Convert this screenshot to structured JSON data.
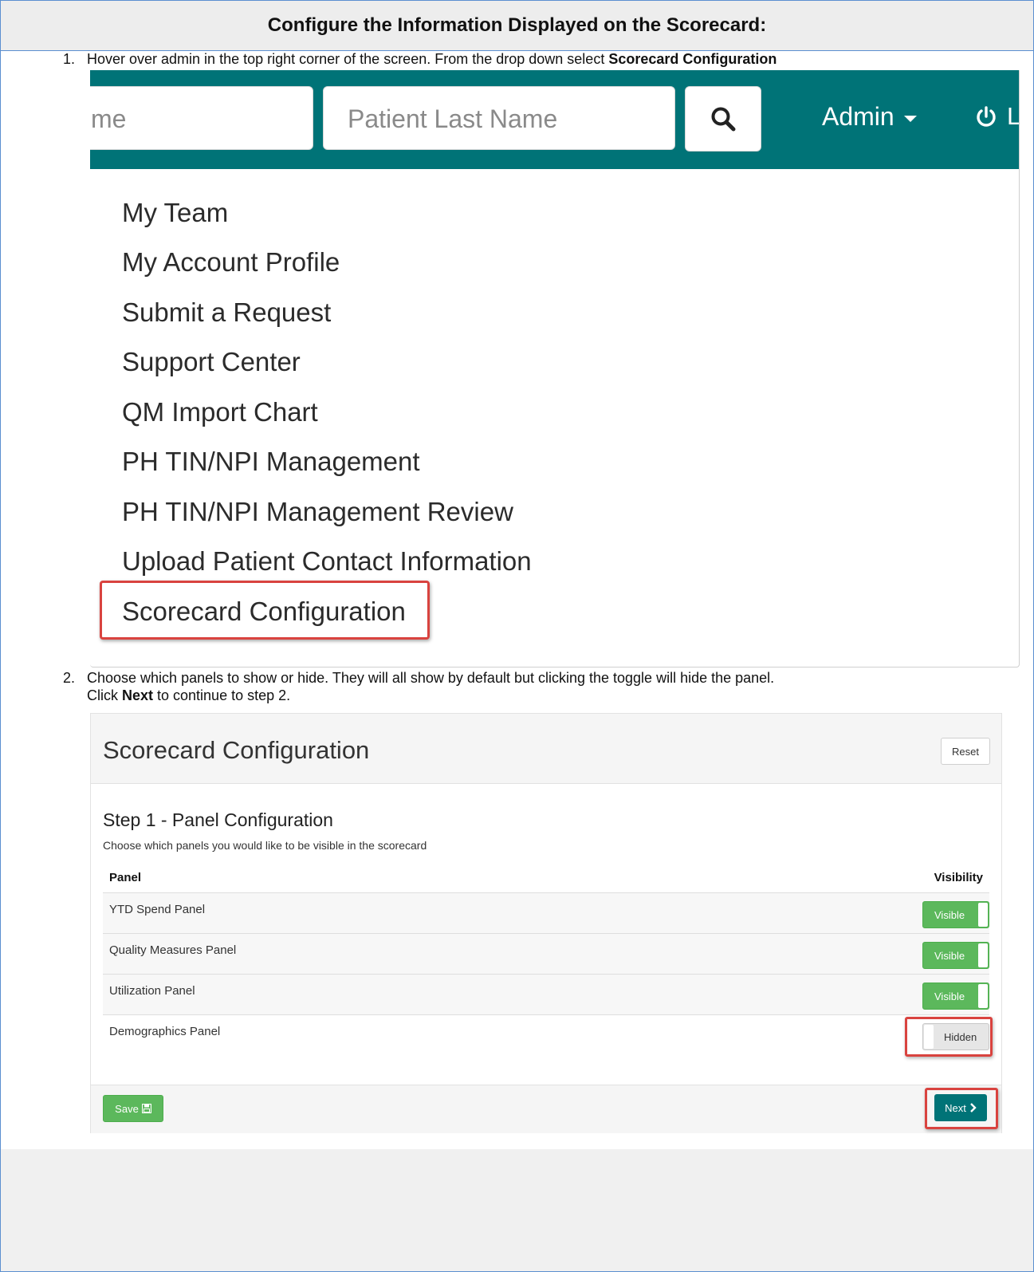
{
  "header": {
    "title": "Configure the Information Displayed on the Scorecard:"
  },
  "steps": [
    {
      "number": "1.",
      "text": "Hover over admin in the top right corner of the screen. From the drop down select ",
      "bold": "Scorecard Configuration"
    },
    {
      "number": "2.",
      "line1": "Choose which panels to show or hide. They will all show by default but clicking the toggle will hide the panel.",
      "line2_prefix": "Click ",
      "line2_bold": "Next",
      "line2_suffix": " to continue to step 2."
    }
  ],
  "navbar": {
    "first_input_text": "me",
    "last_name_placeholder": "Patient Last Name",
    "admin_label": "Admin",
    "logout_label": "Logout",
    "colors": {
      "navbar_bg": "#007377"
    }
  },
  "dropdown": {
    "items": [
      "My Team",
      "My Account Profile",
      "Submit a Request",
      "Support Center",
      "QM Import Chart",
      "PH TIN/NPI Management",
      "PH TIN/NPI Management Review",
      "Upload Patient Contact Information",
      "Scorecard Configuration"
    ],
    "highlighted_item": "Scorecard Configuration"
  },
  "scorecard": {
    "title": "Scorecard Configuration",
    "reset_label": "Reset",
    "step_title": "Step 1 - Panel Configuration",
    "step_desc": "Choose which panels you would like to be visible in the scorecard",
    "col_panel": "Panel",
    "col_visibility": "Visibility",
    "rows": [
      {
        "name": "YTD Spend Panel",
        "state": "Visible"
      },
      {
        "name": "Quality Measures Panel",
        "state": "Visible"
      },
      {
        "name": "Utilization Panel",
        "state": "Visible"
      },
      {
        "name": "Demographics Panel",
        "state": "Hidden"
      }
    ],
    "save_label": "Save",
    "next_label": "Next",
    "colors": {
      "visible": "#5cb85c",
      "next": "#007377",
      "highlight": "#d9433f"
    }
  }
}
